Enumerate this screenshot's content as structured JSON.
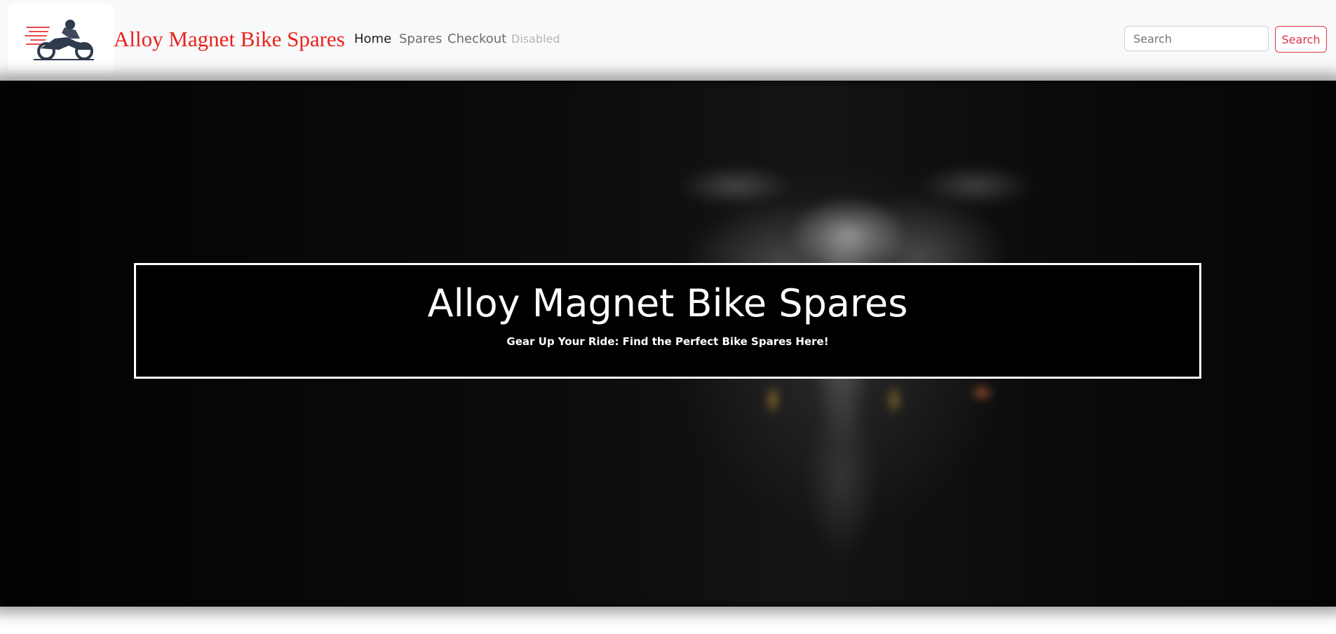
{
  "header": {
    "brand": "Alloy Magnet Bike Spares",
    "nav": {
      "home": "Home",
      "spares": "Spares",
      "checkout": "Checkout",
      "disabled": "Disabled"
    },
    "search": {
      "placeholder": "Search",
      "value": "",
      "button_label": "Search"
    },
    "logo_icon": "motorcycle-rider-icon"
  },
  "hero": {
    "title": "Alloy Magnet Bike Spares",
    "subtitle": "Gear Up Your Ride: Find the Perfect Bike Spares Here!"
  },
  "colors": {
    "brand": "#e8221b",
    "search_button": "#dc3545",
    "navbar_bg": "#f8f9fa",
    "hero_box": "#000000"
  }
}
